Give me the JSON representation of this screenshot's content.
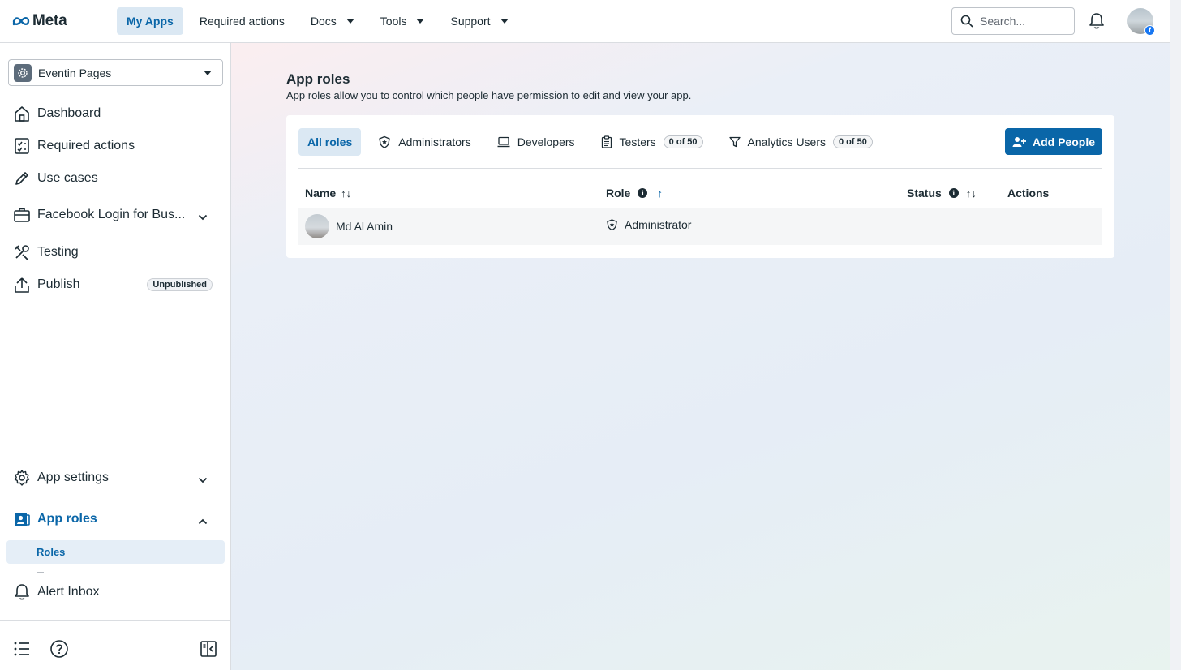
{
  "topnav": {
    "logo_text": "Meta",
    "items": [
      {
        "label": "My Apps"
      },
      {
        "label": "Required actions"
      },
      {
        "label": "Docs"
      },
      {
        "label": "Tools"
      },
      {
        "label": "Support"
      }
    ],
    "search_placeholder": "Search..."
  },
  "sidebar": {
    "app_name": "Eventin Pages",
    "items": [
      {
        "label": "Dashboard"
      },
      {
        "label": "Required actions"
      },
      {
        "label": "Use cases"
      },
      {
        "label": "Facebook Login for Bus..."
      },
      {
        "label": "Testing"
      },
      {
        "label": "Publish",
        "badge": "Unpublished"
      },
      {
        "label": "App settings"
      },
      {
        "label": "App roles"
      },
      {
        "label": "Alert Inbox"
      }
    ],
    "sub_items": [
      {
        "label": "Roles"
      }
    ]
  },
  "main": {
    "title": "App roles",
    "subtitle": "App roles allow you to control which people have permission to edit and view your app.",
    "tabs": [
      {
        "label": "All roles"
      },
      {
        "label": "Administrators"
      },
      {
        "label": "Developers"
      },
      {
        "label": "Testers",
        "count": "0 of 50"
      },
      {
        "label": "Analytics Users",
        "count": "0 of 50"
      }
    ],
    "add_button": "Add People",
    "columns": {
      "name": "Name",
      "role": "Role",
      "status": "Status",
      "actions": "Actions"
    },
    "rows": [
      {
        "name": "Md Al Amin",
        "role": "Administrator",
        "status": ""
      }
    ]
  },
  "colors": {
    "accent": "#0a66a8",
    "accent_bg": "#dbe8f3",
    "text": "#1c2b33"
  }
}
